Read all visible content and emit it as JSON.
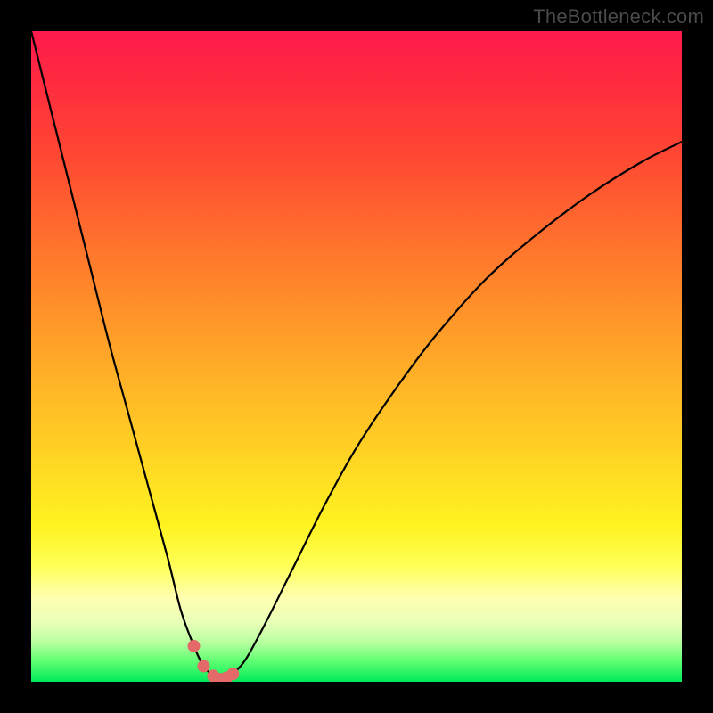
{
  "watermark": "TheBottleneck.com",
  "colors": {
    "background": "#000000",
    "curve": "#000000",
    "marker": "#e46a6a",
    "gradient_top": "#ff1a4d",
    "gradient_bottom": "#00e85a"
  },
  "chart_data": {
    "type": "line",
    "title": "",
    "xlabel": "",
    "ylabel": "",
    "xlim": [
      0,
      100
    ],
    "ylim": [
      0,
      100
    ],
    "series": [
      {
        "name": "bottleneck-curve",
        "x": [
          0,
          3,
          6,
          9,
          12,
          15,
          18,
          21,
          23,
          25,
          26.5,
          28,
          29,
          30,
          31,
          33,
          36,
          40,
          45,
          50,
          56,
          62,
          70,
          78,
          86,
          94,
          100
        ],
        "y": [
          100,
          88,
          76,
          64,
          52,
          41,
          30,
          19,
          11,
          5.5,
          2.4,
          0.9,
          0.4,
          0.6,
          1.2,
          3.5,
          9,
          17,
          27,
          36,
          45,
          53,
          62,
          69,
          75,
          80,
          83
        ]
      }
    ],
    "markers": {
      "name": "highlight-points",
      "x": [
        25.0,
        26.5,
        28.0,
        29.0,
        30.0,
        31.0
      ],
      "y": [
        5.5,
        2.4,
        0.9,
        0.4,
        0.6,
        1.2
      ]
    }
  }
}
